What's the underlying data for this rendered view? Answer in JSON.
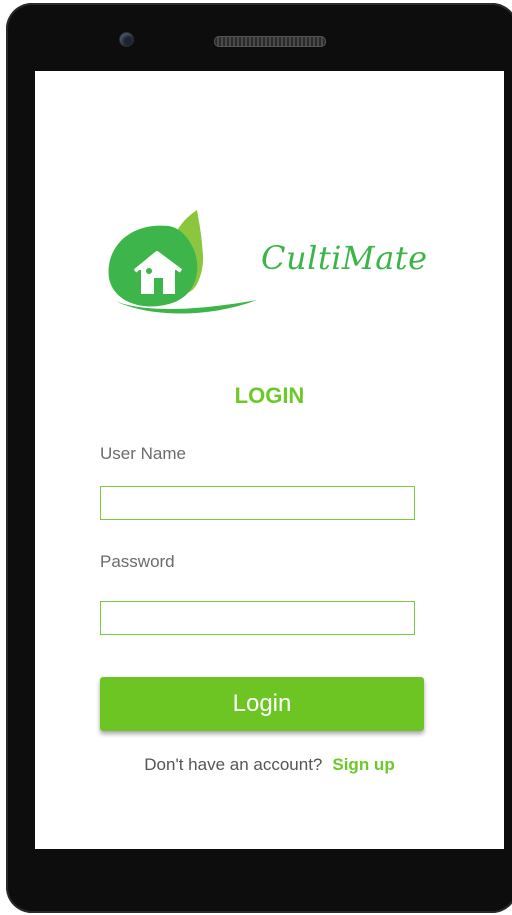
{
  "app": {
    "brand": "CultiMate"
  },
  "login": {
    "title": "LOGIN",
    "username_label": "User Name",
    "username_value": "",
    "password_label": "Password",
    "password_value": "",
    "login_button": "Login"
  },
  "signup": {
    "prompt": "Don't have an account?",
    "link": "Sign up"
  },
  "colors": {
    "accent": "#6dc524",
    "brand_green": "#3cb548",
    "device_frame": "#0d0d0d"
  },
  "icons": {
    "logo": "leaf-house-logo"
  }
}
